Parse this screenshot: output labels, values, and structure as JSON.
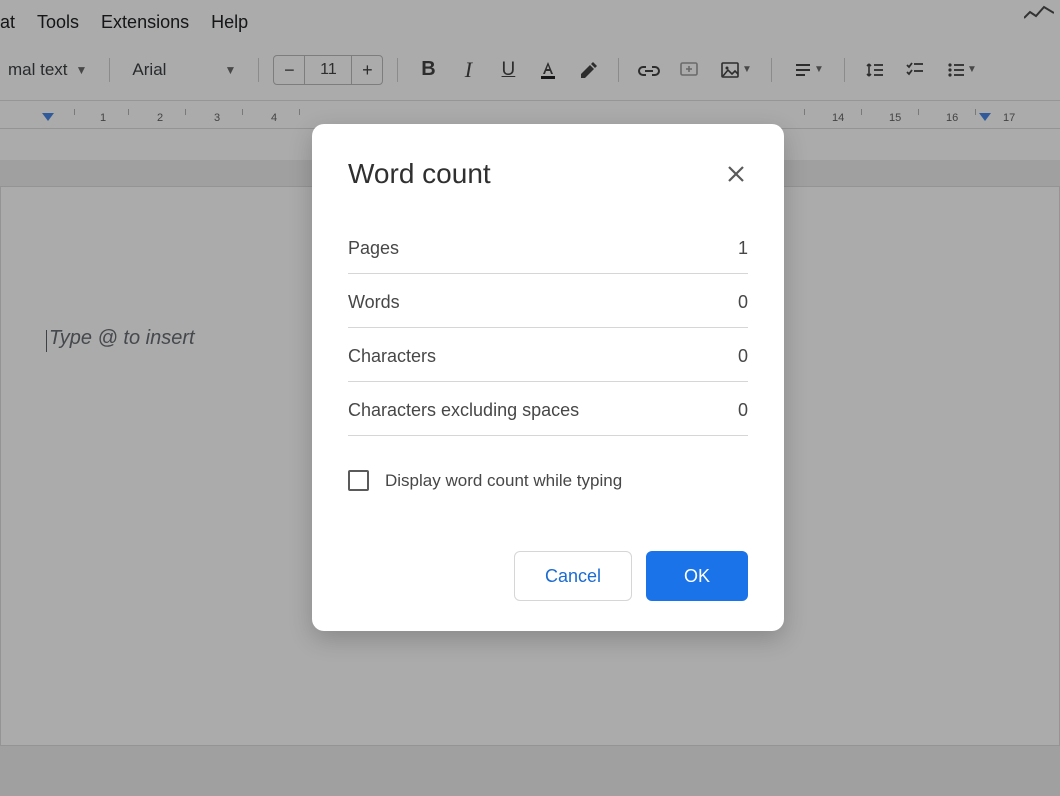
{
  "menu": {
    "format_partial": "at",
    "tools": "Tools",
    "extensions": "Extensions",
    "help": "Help"
  },
  "toolbar": {
    "style_label_partial": "mal text",
    "font_label": "Arial",
    "font_size": "11"
  },
  "ruler": {
    "marks": [
      1,
      2,
      3,
      4,
      14,
      15,
      16,
      17
    ]
  },
  "document": {
    "placeholder": "Type @ to insert"
  },
  "dialog": {
    "title": "Word count",
    "rows": [
      {
        "label": "Pages",
        "value": "1"
      },
      {
        "label": "Words",
        "value": "0"
      },
      {
        "label": "Characters",
        "value": "0"
      },
      {
        "label": "Characters excluding spaces",
        "value": "0"
      }
    ],
    "checkbox_label": "Display word count while typing",
    "cancel": "Cancel",
    "ok": "OK"
  }
}
